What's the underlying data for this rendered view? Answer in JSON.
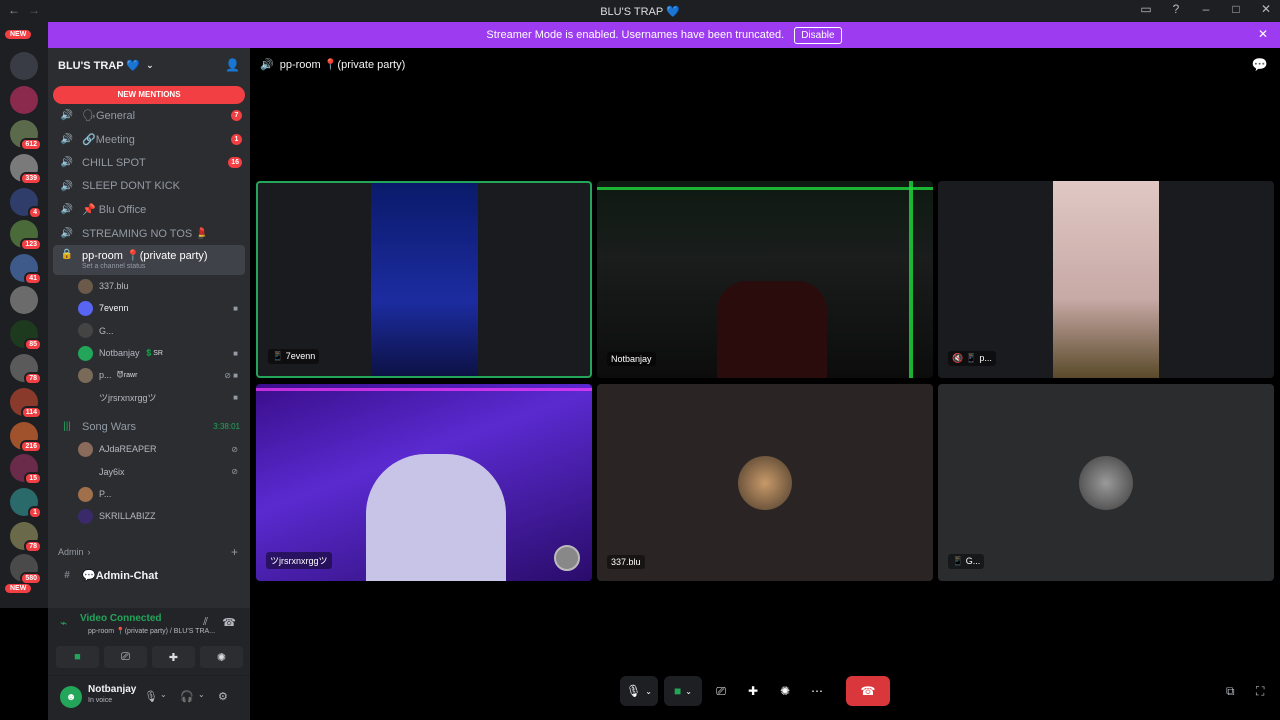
{
  "window": {
    "title": "BLU'S TRAP 💙"
  },
  "banner": {
    "text": "Streamer Mode is enabled. Usernames have been truncated.",
    "disable_label": "Disable"
  },
  "serverbar": {
    "new_top": "NEW",
    "new_bottom": "NEW",
    "badges": [
      "612",
      "339",
      "4",
      "123",
      "41",
      "85",
      "78",
      "114",
      "216",
      "15",
      "1",
      "78",
      "580"
    ]
  },
  "guild": {
    "name": "BLU'S TRAP 💙",
    "new_mentions": "NEW MENTIONS"
  },
  "channels": [
    {
      "name": "🗣General",
      "badge": "7"
    },
    {
      "name": "🔗Meeting",
      "badge": "1"
    },
    {
      "name": "CHILL SPOT",
      "badge": "16"
    },
    {
      "name": "SLEEP DONT KICK",
      "badge": ""
    },
    {
      "name": "📌 Blu Office",
      "badge": ""
    },
    {
      "name": "STREAMING NO TOS 💄",
      "badge": ""
    }
  ],
  "active_channel": {
    "name": "pp-room 📍(private party)",
    "status": "Set a channel status"
  },
  "voice_users": [
    {
      "name": "337.blu",
      "tag": ""
    },
    {
      "name": "7evenn",
      "tag": ""
    },
    {
      "name": "G...",
      "tag": ""
    },
    {
      "name": "Notbanjay",
      "tag": "💲SR"
    },
    {
      "name": "p...",
      "tag": "😈rawr"
    },
    {
      "name": "ツjrsrxnxrggツ",
      "tag": ""
    }
  ],
  "song_wars": {
    "name": "Song Wars",
    "timer": "3:38:01",
    "users": [
      "AJdaREAPER",
      "Jay6ix",
      "P...",
      "SKRILLABIZZ"
    ]
  },
  "admin_category": {
    "label": "Admin",
    "channel": "💬Admin-Chat"
  },
  "voice_connection": {
    "status": "Video Connected",
    "location": "pp-room 📍(private party) / BLU'S TRA..."
  },
  "user": {
    "name": "Notbanjay",
    "status": "In voice"
  },
  "stage": {
    "channel": "pp-room 📍(private party)",
    "tiles": [
      {
        "label": "📱 7evenn",
        "speaking": true
      },
      {
        "label": "Notbanjay",
        "speaking": false
      },
      {
        "label": "🔇 📱 p...",
        "speaking": false
      },
      {
        "label": "ツjrsrxnxrggツ",
        "speaking": false
      },
      {
        "label": "337.blu",
        "speaking": false
      },
      {
        "label": "📱 G...",
        "speaking": false
      }
    ]
  },
  "colors": {
    "accent": "#9c3bf0",
    "danger": "#f23f43",
    "connected": "#23a55a",
    "sidebar": "#2b2d31"
  }
}
